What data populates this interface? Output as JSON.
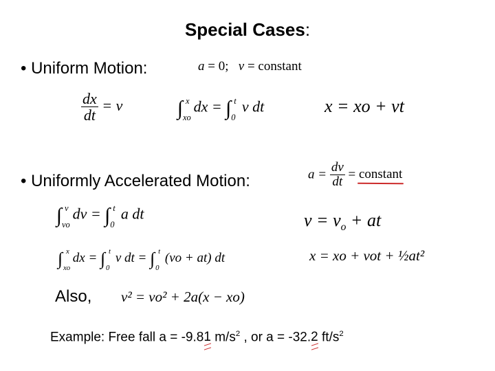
{
  "slide": {
    "title": "Special Cases",
    "title_colon": ":",
    "uniform": {
      "heading": "• Uniform Motion:",
      "condition_a": "a",
      "condition_a_rest": " = 0;",
      "condition_v": "v",
      "condition_v_rest": " = constant",
      "eq1_num": "dx",
      "eq1_den": "dt",
      "eq1_rhs": "= v",
      "eq2_int1_upper": "x",
      "eq2_int1_lower": "xo",
      "eq2_mid": "dx =",
      "eq2_int2_upper": "t",
      "eq2_int2_lower": "0",
      "eq2_rhs": "v dt",
      "eq3": "x = xo + vt"
    },
    "accelerated": {
      "heading": "• Uniformly Accelerated Motion:",
      "def_lhs": "a =",
      "def_num": "dv",
      "def_den": "dt",
      "def_eq": "=",
      "def_rhs": "constant",
      "eq1_upper": "v",
      "eq1_lower": "vo",
      "eq1_mid": "dv =",
      "eq1_upper2": "t",
      "eq1_lower2": "0",
      "eq1_rhs": "a dt",
      "eq1_result_v": "v = v",
      "eq1_result_sub": "o",
      "eq1_result_rest": " + at",
      "eq2_upper": "x",
      "eq2_lower": "xo",
      "eq2_mid": "dx =",
      "eq2_upper2": "t",
      "eq2_lower2": "0",
      "eq2_mid2": "v dt =",
      "eq2_upper3": "t",
      "eq2_lower3": "0",
      "eq2_rhs": "(vo + at) dt",
      "eq2_result": "x = xo + vot + ½at²"
    },
    "also": {
      "label": "Also,",
      "equation": "v² = vo² + 2a(x − xo)"
    },
    "example": {
      "prefix": "Example:  Free fall  a = -9.8",
      "digit1": "1",
      "unit1": " m/s",
      "exp1": "2",
      "middle": " , or  a = -32.",
      "digit2": "2",
      "unit2": " ft/s",
      "exp2": "2"
    }
  },
  "colors": {
    "annotation_red": "#cc2a2a",
    "text": "#000000",
    "background": "#ffffff"
  }
}
